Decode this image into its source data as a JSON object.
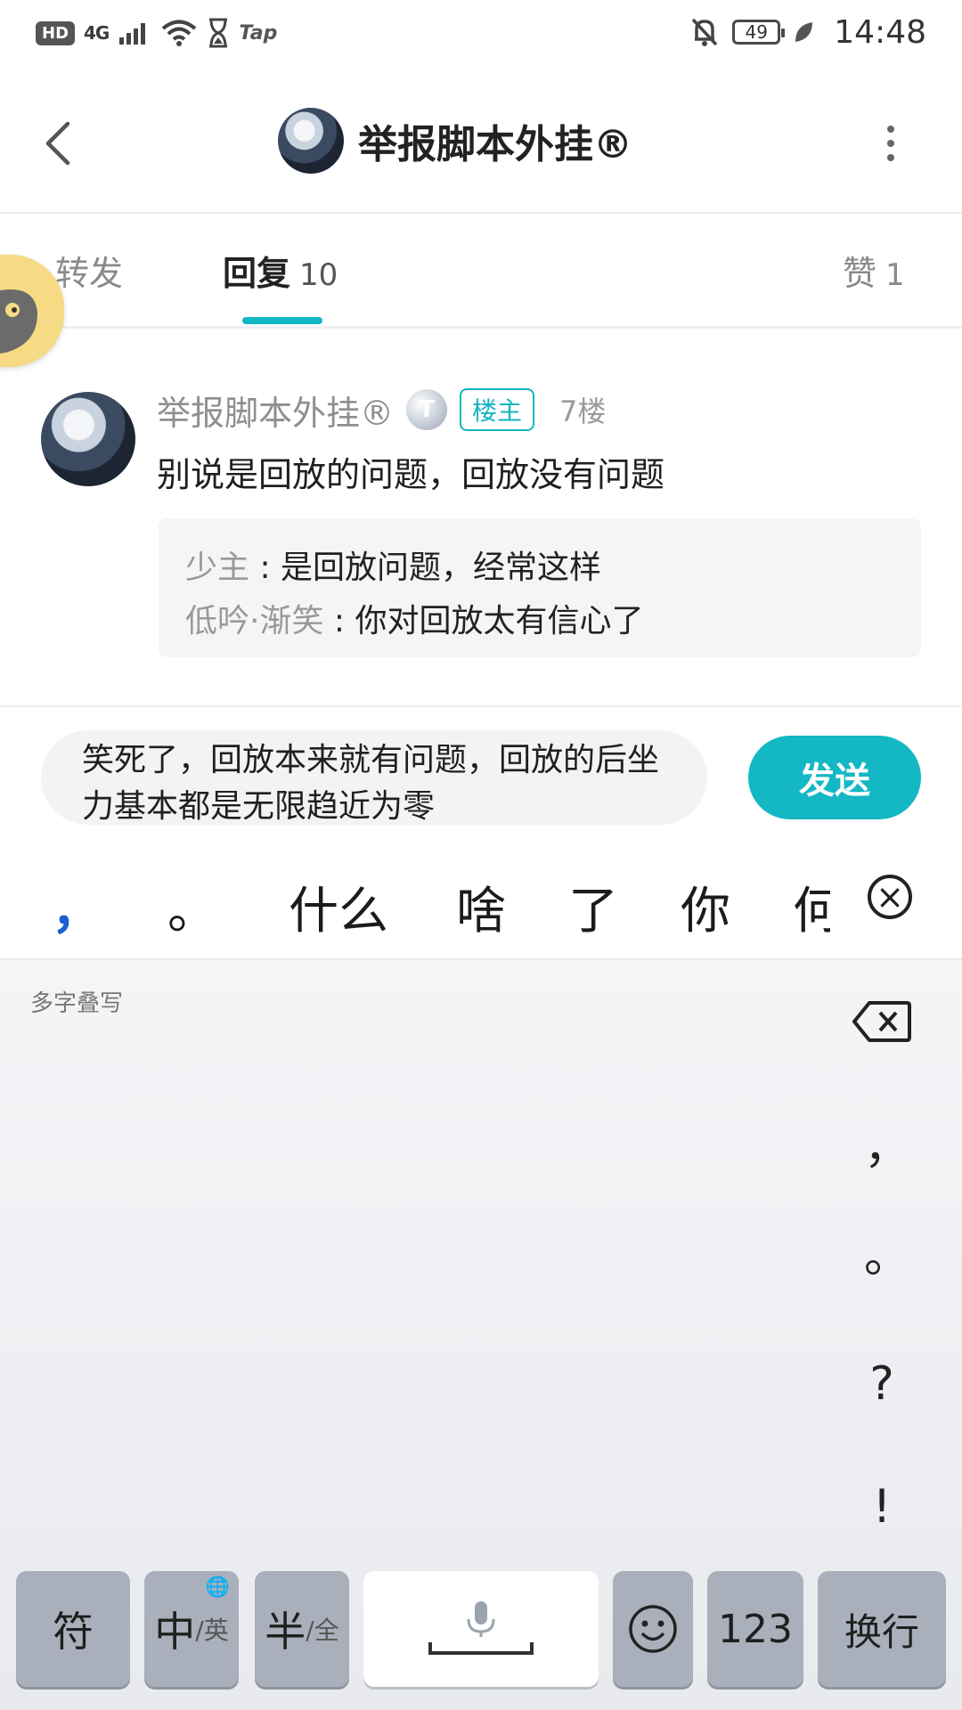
{
  "status_bar": {
    "left": {
      "hd": "HD",
      "signal": "4G",
      "app": "Tap"
    },
    "battery": "49",
    "time": "14:48"
  },
  "header": {
    "title": "举报脚本外挂®",
    "icons": {
      "back": "back-arrow-icon",
      "more": "more-vertical-icon"
    }
  },
  "tabs": [
    {
      "label": "转发",
      "count": ""
    },
    {
      "label": "回复",
      "count": "10"
    },
    {
      "label": "赞",
      "count": "1"
    }
  ],
  "comment": {
    "author": "举报脚本外挂®",
    "level_badge": "T",
    "owner_badge": "楼主",
    "floor": "7楼",
    "text": "别说是回放的问题，回放没有问题",
    "replies": [
      {
        "author": "少主",
        "sep": " : ",
        "text": "是回放问题，经常这样"
      },
      {
        "author": "低吟·渐笑",
        "sep": " : ",
        "text": "你对回放太有信心了"
      }
    ]
  },
  "input": {
    "value": "笑死了，回放本来就有问题，回放的后坐力基本都是无限趋近为零",
    "send_label": "发送"
  },
  "candidates": [
    "，",
    "。",
    "什么",
    "啥",
    "了",
    "你",
    "何"
  ],
  "keyboard": {
    "hint": "多字叠写",
    "side_punct": [
      "，",
      "。",
      "?",
      "!"
    ],
    "keys": {
      "symbol": "符",
      "lang_main": "中",
      "lang_sub": "/英",
      "width_main": "半",
      "width_sub": "/全",
      "num": "123",
      "enter": "换行"
    }
  },
  "colors": {
    "accent": "#14b8c4",
    "candidate_highlight": "#1a5fd0",
    "key_gray": "#a9b0bb"
  }
}
